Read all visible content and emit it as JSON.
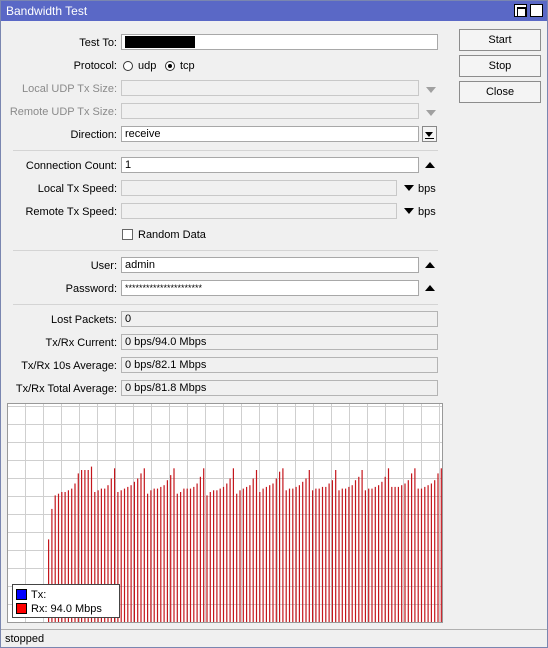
{
  "window": {
    "title": "Bandwidth Test"
  },
  "buttons": {
    "start": "Start",
    "stop": "Stop",
    "close": "Close"
  },
  "form": {
    "test_to_label": "Test To:",
    "test_to_value": "",
    "protocol_label": "Protocol:",
    "protocol_options": [
      "udp",
      "tcp"
    ],
    "protocol_selected": "tcp",
    "local_udp_label": "Local UDP Tx Size:",
    "remote_udp_label": "Remote UDP Tx Size:",
    "direction_label": "Direction:",
    "direction_value": "receive",
    "connection_count_label": "Connection Count:",
    "connection_count_value": "1",
    "local_tx_speed_label": "Local Tx Speed:",
    "remote_tx_speed_label": "Remote Tx Speed:",
    "speed_unit": "bps",
    "random_data_label": "Random Data",
    "random_data_checked": false,
    "user_label": "User:",
    "user_value": "admin",
    "password_label": "Password:",
    "password_value": "**********************"
  },
  "stats": {
    "lost_packets_label": "Lost Packets:",
    "lost_packets_value": "0",
    "current_label": "Tx/Rx Current:",
    "current_value": "0 bps/94.0 Mbps",
    "avg10_label": "Tx/Rx 10s Average:",
    "avg10_value": "0 bps/82.1 Mbps",
    "total_avg_label": "Tx/Rx Total Average:",
    "total_avg_value": "0 bps/81.8 Mbps"
  },
  "legend": {
    "tx_label": "Tx:",
    "rx_label": "Rx:  94.0 Mbps",
    "tx_color": "#0000ff",
    "rx_color": "#ff0000"
  },
  "chart_data": {
    "type": "bar",
    "series": [
      {
        "values": [
          0,
          0,
          0,
          0,
          0,
          0,
          0,
          0,
          0,
          0,
          0,
          0,
          0,
          0,
          0,
          0,
          0,
          0,
          0,
          0,
          0,
          0,
          0,
          0,
          0,
          0,
          0,
          0,
          0,
          0,
          0,
          0,
          0,
          0,
          0,
          0,
          0,
          0,
          0,
          0,
          0,
          0,
          0,
          0,
          0,
          0,
          0,
          0,
          0,
          0,
          0,
          0,
          0,
          0,
          0,
          0,
          0,
          0,
          0,
          0,
          0,
          0,
          0,
          0,
          0,
          0,
          0,
          0,
          0,
          0,
          0,
          0,
          0,
          0,
          0,
          0,
          0,
          0,
          0,
          0,
          0,
          0,
          0,
          0,
          0,
          0,
          0,
          0,
          0,
          0,
          0,
          0,
          0,
          0,
          0,
          0,
          0,
          0,
          0,
          0,
          0,
          0,
          0,
          0,
          0,
          0,
          0,
          0,
          0,
          0,
          0,
          0,
          0,
          0,
          0,
          0,
          0,
          0,
          0,
          0,
          0,
          0,
          0,
          0,
          0,
          0,
          0,
          0,
          0,
          0,
          0,
          0,
          0,
          0,
          0,
          0,
          0
        ]
      },
      {
        "values": [
          0,
          0,
          0,
          0,
          0,
          0,
          0,
          0,
          0,
          0,
          0,
          0,
          0,
          0,
          0,
          0,
          0,
          0,
          0,
          0,
          0,
          0,
          0,
          0,
          0,
          0,
          0,
          0,
          0,
          0,
          0,
          0,
          0,
          0,
          0,
          0,
          0,
          0,
          0,
          0,
          0,
          0,
          0,
          0,
          0,
          0,
          0,
          0,
          0,
          0,
          0,
          0,
          0,
          0,
          0,
          0,
          0,
          0,
          0,
          0,
          0,
          0,
          0,
          0,
          0,
          0,
          0,
          0,
          0,
          0,
          0,
          0,
          0,
          0,
          0,
          0,
          0,
          0,
          0,
          0,
          0,
          0,
          0,
          0,
          0,
          0,
          0,
          0,
          0,
          0,
          0,
          0,
          0,
          0,
          0,
          0,
          0,
          0,
          0,
          0,
          0,
          0,
          0,
          0,
          0,
          0,
          0,
          0,
          0,
          0,
          0,
          0,
          0,
          0,
          0,
          0,
          0,
          0,
          0,
          0,
          0,
          0,
          0,
          0,
          0,
          0,
          0,
          0,
          0,
          0,
          0,
          0,
          0,
          0,
          0,
          0,
          0
        ]
      }
    ],
    "rx_pattern": [
      0,
      0,
      0,
      0,
      0,
      0,
      0,
      0,
      0,
      0,
      0,
      0,
      50,
      68,
      76,
      77,
      78,
      78,
      79,
      80,
      83,
      89,
      91,
      91,
      91,
      93,
      78,
      79,
      80,
      80,
      82,
      86,
      92,
      78,
      79,
      80,
      81,
      82,
      84,
      86,
      89,
      92,
      77,
      79,
      80,
      80,
      81,
      82,
      85,
      88,
      92,
      77,
      78,
      80,
      80,
      80,
      81,
      83,
      87,
      92,
      76,
      78,
      79,
      79,
      80,
      81,
      83,
      86,
      92,
      77,
      79,
      80,
      81,
      82,
      86,
      91,
      78,
      80,
      81,
      82,
      83,
      86,
      90,
      92,
      79,
      80,
      80,
      81,
      82,
      84,
      86,
      91,
      79,
      80,
      80,
      81,
      81,
      83,
      85,
      91,
      79,
      80,
      80,
      81,
      82,
      85,
      87,
      91,
      79,
      80,
      80,
      81,
      82,
      84,
      87,
      92,
      81,
      81,
      81,
      82,
      83,
      85,
      89,
      92,
      80,
      80,
      81,
      82,
      83,
      85,
      89,
      92
    ],
    "ylim": [
      0,
      130
    ]
  },
  "status": {
    "text": "stopped"
  }
}
